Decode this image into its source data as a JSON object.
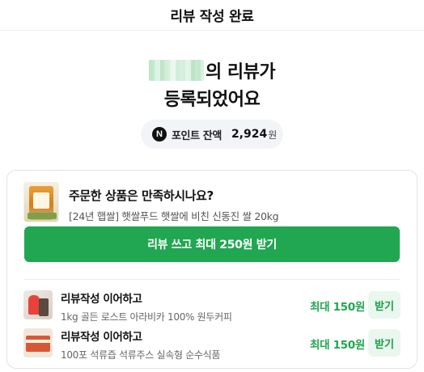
{
  "header": {
    "title": "리뷰 작성 완료"
  },
  "hero": {
    "line1_suffix": "의 리뷰가",
    "line2": "등록되었어요"
  },
  "points": {
    "icon_letter": "N",
    "label": "포인트 잔액",
    "value": "2,924",
    "unit": "원"
  },
  "product": {
    "question": "주문한 상품은 만족하시나요?",
    "name": "[24년 햅쌀] 햇쌀푸드 햇쌀에 비친 신동진 쌀 20kg"
  },
  "cta": {
    "label": "리뷰 쓰고 최대 250원 받기"
  },
  "recommendations": [
    {
      "title": "리뷰작성 이어하고",
      "product": "1kg 골든 로스트 아라비카 100% 원두커피",
      "amount": "최대 150원",
      "button": "받기"
    },
    {
      "title": "리뷰작성 이어하고",
      "product": "100포 석류즙 석류주스 실속형 순수식품",
      "amount": "최대 150원",
      "button": "받기"
    }
  ],
  "colors": {
    "accent": "#21a651",
    "accent_light": "#e9f7ee"
  }
}
